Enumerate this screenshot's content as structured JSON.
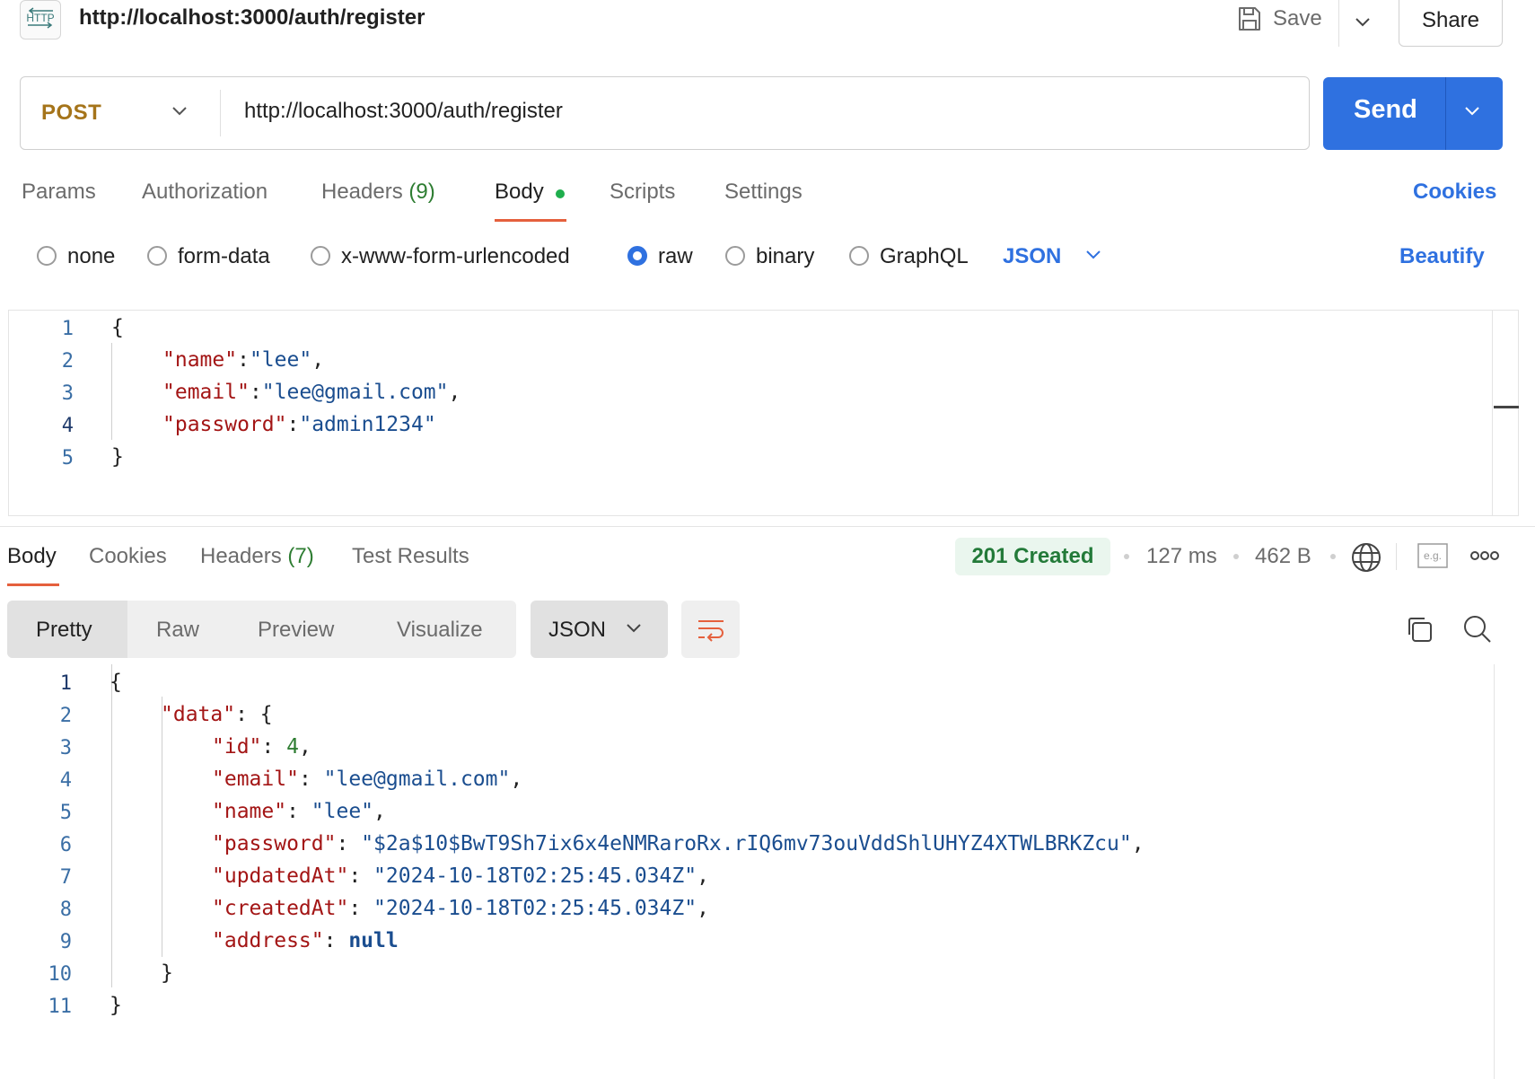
{
  "header": {
    "icon_text": "HTTP",
    "title": "http://localhost:3000/auth/register",
    "save_label": "Save",
    "share_label": "Share"
  },
  "request": {
    "method": "POST",
    "url": "http://localhost:3000/auth/register",
    "send_label": "Send",
    "tabs": [
      {
        "label": "Params"
      },
      {
        "label": "Authorization"
      },
      {
        "label": "Headers",
        "count": "(9)"
      },
      {
        "label": "Body"
      },
      {
        "label": "Scripts"
      },
      {
        "label": "Settings"
      }
    ],
    "cookies_label": "Cookies",
    "body_types": [
      "none",
      "form-data",
      "x-www-form-urlencoded",
      "raw",
      "binary",
      "GraphQL"
    ],
    "selected_body_type": "raw",
    "format": "JSON",
    "beautify_label": "Beautify",
    "line_numbers": [
      "1",
      "2",
      "3",
      "4",
      "5"
    ],
    "body_lines": [
      {
        "open": "{"
      },
      {
        "key": "\"name\"",
        "sep": ":",
        "value": "\"lee\"",
        "end": ","
      },
      {
        "key": "\"email\"",
        "sep": ":",
        "value": "\"lee@gmail.com\"",
        "end": ","
      },
      {
        "key": "\"password\"",
        "sep": ":",
        "value": "\"admin1234\"",
        "end": ""
      },
      {
        "close": "}"
      }
    ]
  },
  "response": {
    "tabs": [
      {
        "label": "Body"
      },
      {
        "label": "Cookies"
      },
      {
        "label": "Headers",
        "count": "(7)"
      },
      {
        "label": "Test Results"
      }
    ],
    "status": "201 Created",
    "time": "127 ms",
    "size": "462 B",
    "example_icon_text": "e.g.",
    "view_modes": [
      "Pretty",
      "Raw",
      "Preview",
      "Visualize"
    ],
    "format": "JSON",
    "line_numbers": [
      "1",
      "2",
      "3",
      "4",
      "5",
      "6",
      "7",
      "8",
      "9",
      "10",
      "11"
    ],
    "body": {
      "open": "{",
      "data_key": "\"data\"",
      "data_open": "{",
      "fields": [
        {
          "key": "\"id\"",
          "value": "4",
          "type": "num",
          "end": ","
        },
        {
          "key": "\"email\"",
          "value": "\"lee@gmail.com\"",
          "type": "str",
          "end": ","
        },
        {
          "key": "\"name\"",
          "value": "\"lee\"",
          "type": "str",
          "end": ","
        },
        {
          "key": "\"password\"",
          "value": "\"$2a$10$BwT9Sh7ix6x4eNMRaroRx.rIQ6mv73ouVddShlUHYZ4XTWLBRKZcu\"",
          "type": "str",
          "end": ","
        },
        {
          "key": "\"updatedAt\"",
          "value": "\"2024-10-18T02:25:45.034Z\"",
          "type": "str",
          "end": ","
        },
        {
          "key": "\"createdAt\"",
          "value": "\"2024-10-18T02:25:45.034Z\"",
          "type": "str",
          "end": ","
        },
        {
          "key": "\"address\"",
          "value": "null",
          "type": "kw",
          "end": ""
        }
      ],
      "data_close": "}",
      "close": "}"
    }
  },
  "colors": {
    "accent": "#2f71e0",
    "method": "#a5741a",
    "status_bg": "#eaf6ee",
    "status_text": "#237a39",
    "tab_underline": "#e5603d"
  }
}
